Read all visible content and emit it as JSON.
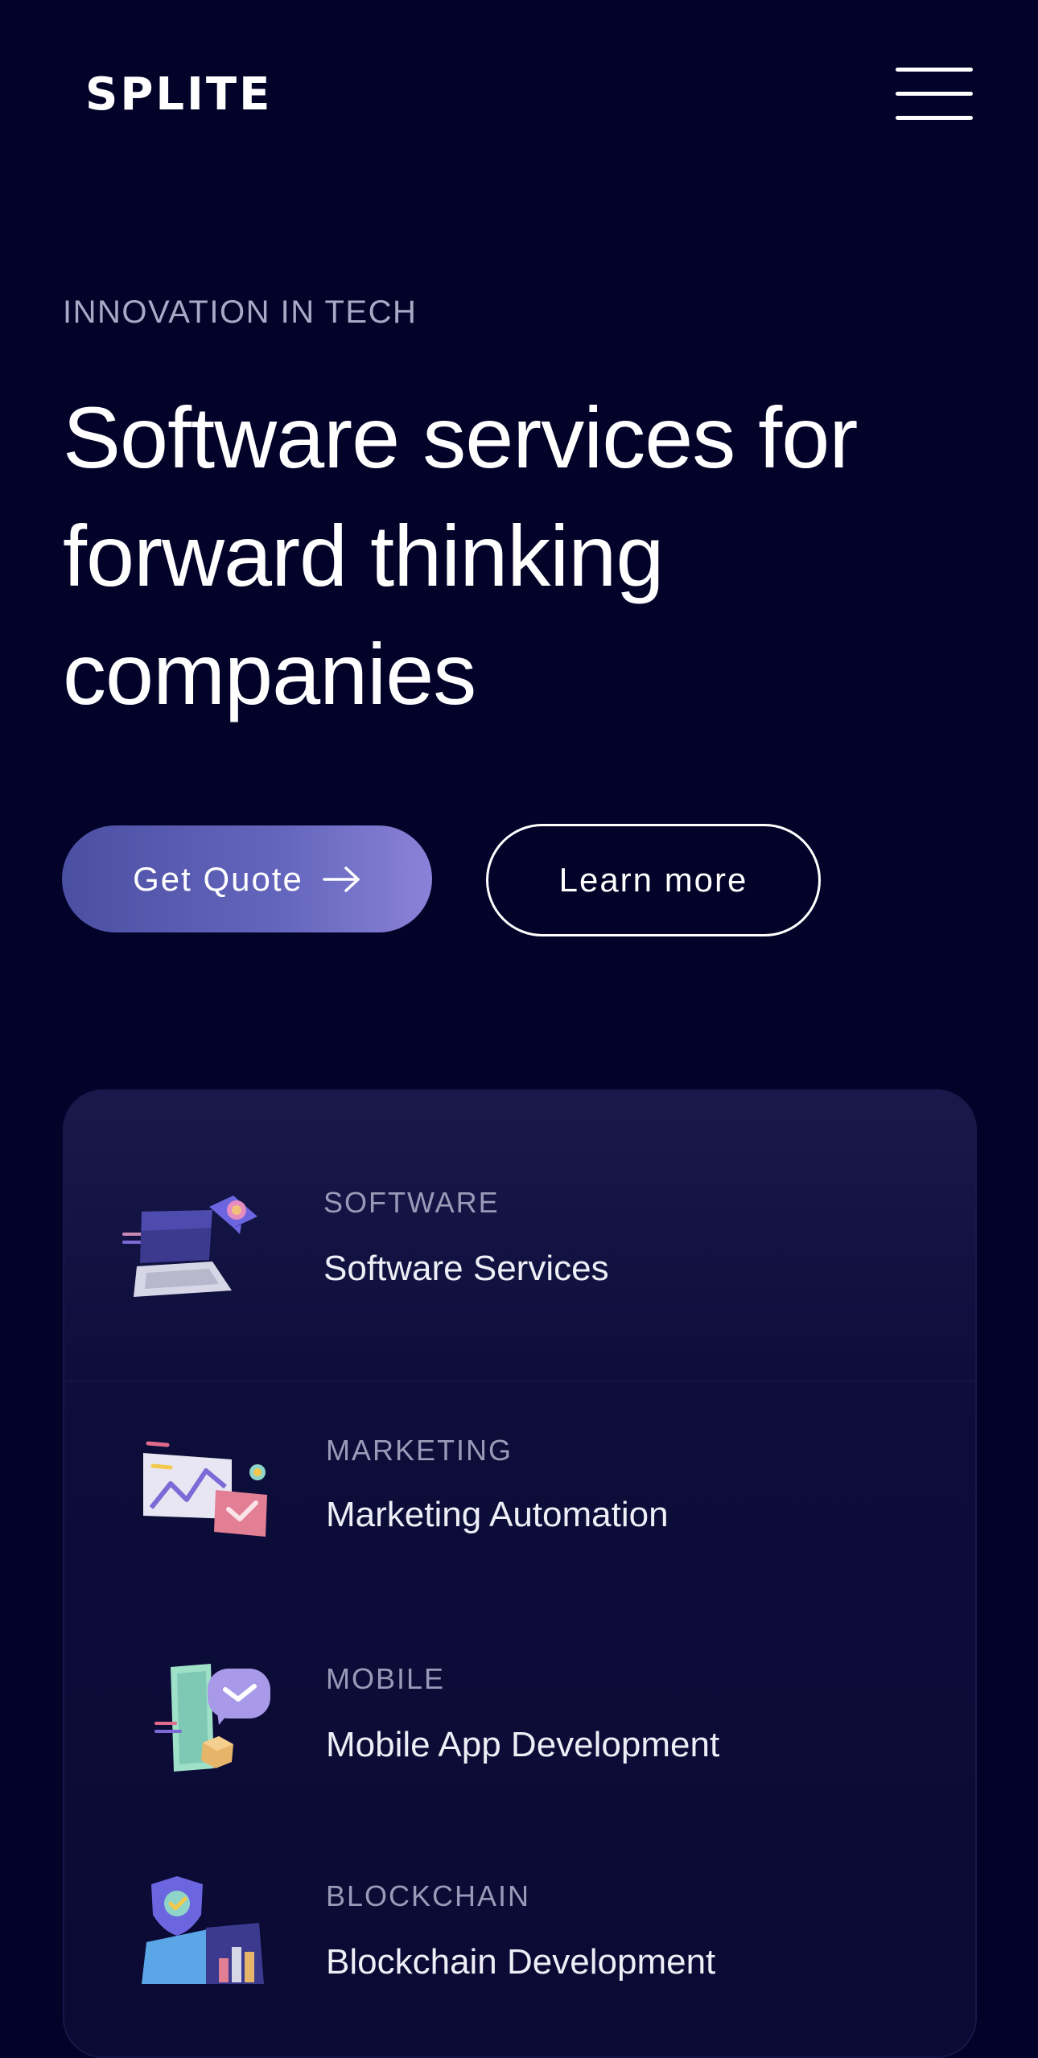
{
  "header": {
    "logo": "SPLITE",
    "menu_icon": "hamburger-menu-icon"
  },
  "hero": {
    "eyebrow": "INNOVATION IN TECH",
    "title_line1": "Software services for",
    "title_line2": "forward thinking",
    "title_line3": "companies",
    "primary_button": "Get Quote",
    "primary_button_icon": "arrow-right-icon",
    "secondary_button": "Learn more"
  },
  "services": [
    {
      "category": "SOFTWARE",
      "name": "Software Services",
      "icon": "laptop-illustration-icon"
    },
    {
      "category": "MARKETING",
      "name": "Marketing Automation",
      "icon": "chart-mail-illustration-icon"
    },
    {
      "category": "MOBILE",
      "name": "Mobile App Development",
      "icon": "phone-chat-illustration-icon"
    },
    {
      "category": "BLOCKCHAIN",
      "name": "Blockchain Development",
      "icon": "shield-chart-illustration-icon"
    }
  ],
  "colors": {
    "background": "#03032a",
    "card": "#10103f",
    "accent_gradient_start": "#4b4fa3",
    "accent_gradient_end": "#8a82d8",
    "muted_text": "#a9a9c6"
  }
}
